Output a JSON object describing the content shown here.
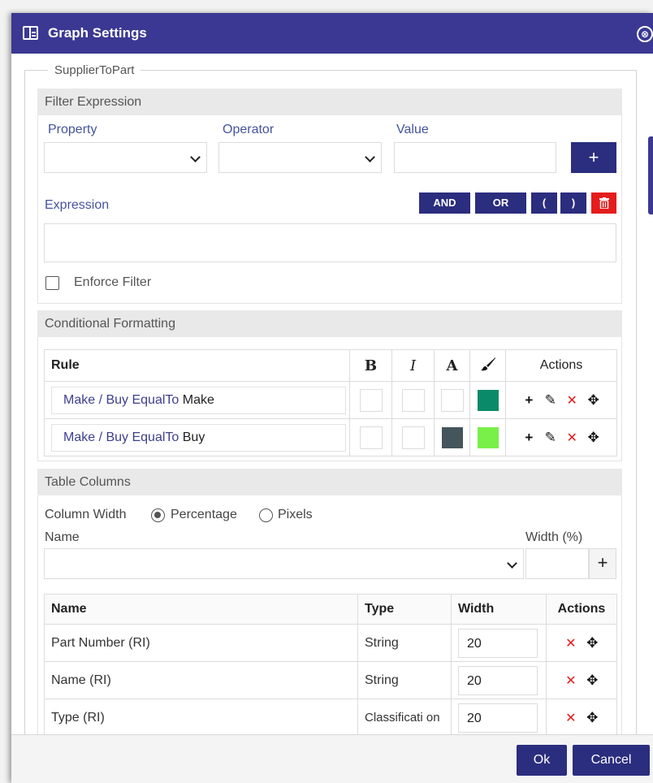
{
  "dialog": {
    "title": "Graph Settings",
    "close_glyph": "⊗"
  },
  "icons": {
    "title": "window-icon",
    "close": "close-circle-icon",
    "add": "plus-icon",
    "edit": "pencil-icon",
    "delete": "x-icon",
    "move": "move-icon",
    "trash": "trash-icon",
    "paint": "paintbrush-icon"
  },
  "fieldset_legend": "SupplierToPart",
  "filter": {
    "header": "Filter Expression",
    "property_label": "Property",
    "operator_label": "Operator",
    "value_label": "Value",
    "property_value": "",
    "operator_value": "",
    "value_value": "",
    "add_glyph": "+",
    "expression_label": "Expression",
    "expression_value": "",
    "and_label": "AND",
    "or_label": "OR",
    "open_paren": "(",
    "close_paren": ")",
    "enforce_label": "Enforce Filter",
    "enforce_checked": false
  },
  "conditional": {
    "header": "Conditional Formatting",
    "columns": {
      "rule": "Rule",
      "bold": "B",
      "italic": "I",
      "color": "A",
      "actions": "Actions"
    },
    "rules": [
      {
        "prefix": "Make / Buy EqualTo",
        "value": "Make",
        "text_color": "",
        "fill_color": "#0b8a6a"
      },
      {
        "prefix": "Make / Buy EqualTo",
        "value": "Buy",
        "text_color": "#44555c",
        "fill_color": "#79f04a"
      }
    ],
    "action_glyphs": {
      "add": "+",
      "edit": "✎",
      "delete": "✕",
      "move": "✥"
    }
  },
  "table_columns": {
    "header": "Table Columns",
    "width_label": "Column Width",
    "percentage_label": "Percentage",
    "pixels_label": "Pixels",
    "selected_mode": "Percentage",
    "name_label": "Name",
    "width_pct_label": "Width (%)",
    "name_value": "",
    "width_value": "",
    "add_glyph": "+",
    "grid_headers": {
      "name": "Name",
      "type": "Type",
      "width": "Width",
      "actions": "Actions"
    },
    "rows": [
      {
        "name": "Part Number (RI)",
        "type": "String",
        "width": "20"
      },
      {
        "name": "Name (RI)",
        "type": "String",
        "width": "20"
      },
      {
        "name": "Type (RI)",
        "type": "Classificati on",
        "width": "20"
      }
    ]
  },
  "footer": {
    "ok_label": "Ok",
    "cancel_label": "Cancel"
  },
  "colors": {
    "brand": "#3b3893",
    "button": "#2b2d7e",
    "danger": "#e51c1c"
  }
}
